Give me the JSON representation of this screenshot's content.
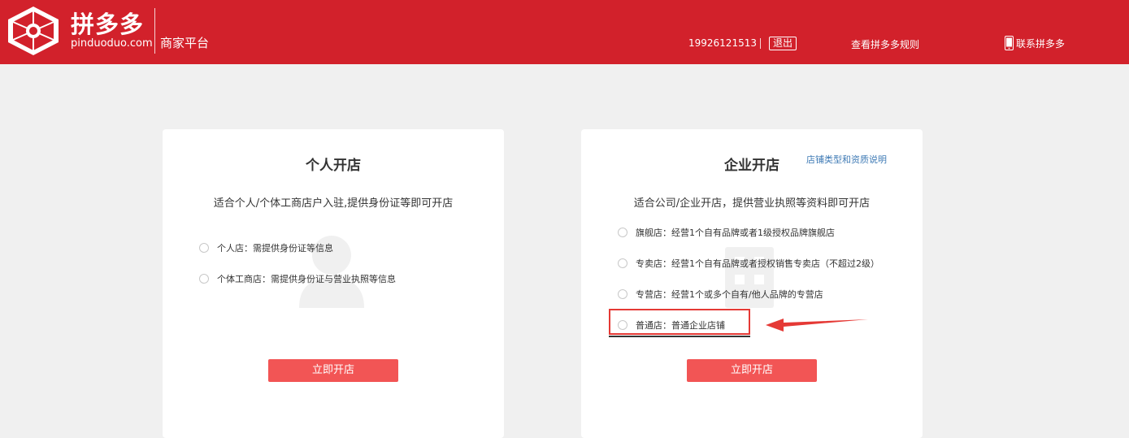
{
  "header": {
    "logo_cn": "拼多多",
    "logo_en": "pinduoduo.com",
    "platform": "商家平台",
    "phone": "19926121513",
    "logout": "退出",
    "rules": "查看拼多多规则",
    "contact": "联系拼多多",
    "brand_color": "#d2212b"
  },
  "personal": {
    "title": "个人开店",
    "desc": "适合个人/个体工商店户入驻,提供身份证等即可开店",
    "options": [
      "个人店：需提供身份证等信息",
      "个体工商店：需提供身份证与营业执照等信息"
    ],
    "button": "立即开店"
  },
  "enterprise": {
    "title": "企业开店",
    "help_link": "店铺类型和资质说明",
    "desc": "适合公司/企业开店，提供营业执照等资料即可开店",
    "options": [
      "旗舰店：经营1个自有品牌或者1级授权品牌旗舰店",
      "专卖店：经营1个自有品牌或者授权销售专卖店（不超过2级）",
      "专营店：经营1个或多个自有/他人品牌的专营店",
      "普通店：普通企业店铺"
    ],
    "button": "立即开店"
  },
  "accent_color": "#f25555",
  "annotation_color": "#e53935"
}
